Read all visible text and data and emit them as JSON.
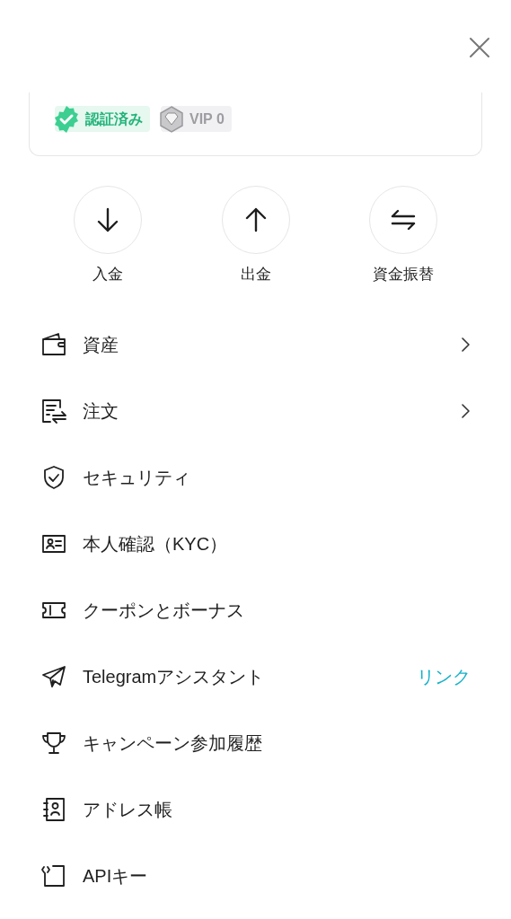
{
  "badges": [
    {
      "kind": "verified",
      "label": "認証済み"
    },
    {
      "kind": "vip",
      "label": "VIP 0"
    }
  ],
  "actions": [
    {
      "label": "入金"
    },
    {
      "label": "出金"
    },
    {
      "label": "資金振替"
    }
  ],
  "menu": [
    {
      "label": "資産",
      "kind": "chevron"
    },
    {
      "label": "注文",
      "kind": "chevron"
    },
    {
      "label": "セキュリティ",
      "kind": "plain"
    },
    {
      "label": "本人確認（KYC）",
      "kind": "plain"
    },
    {
      "label": "クーポンとボーナス",
      "kind": "plain"
    },
    {
      "label": "Telegramアシスタント",
      "kind": "link",
      "link": "リンク"
    },
    {
      "label": "キャンペーン参加履歴",
      "kind": "plain"
    },
    {
      "label": "アドレス帳",
      "kind": "plain"
    },
    {
      "label": "APIキー",
      "kind": "plain"
    }
  ]
}
